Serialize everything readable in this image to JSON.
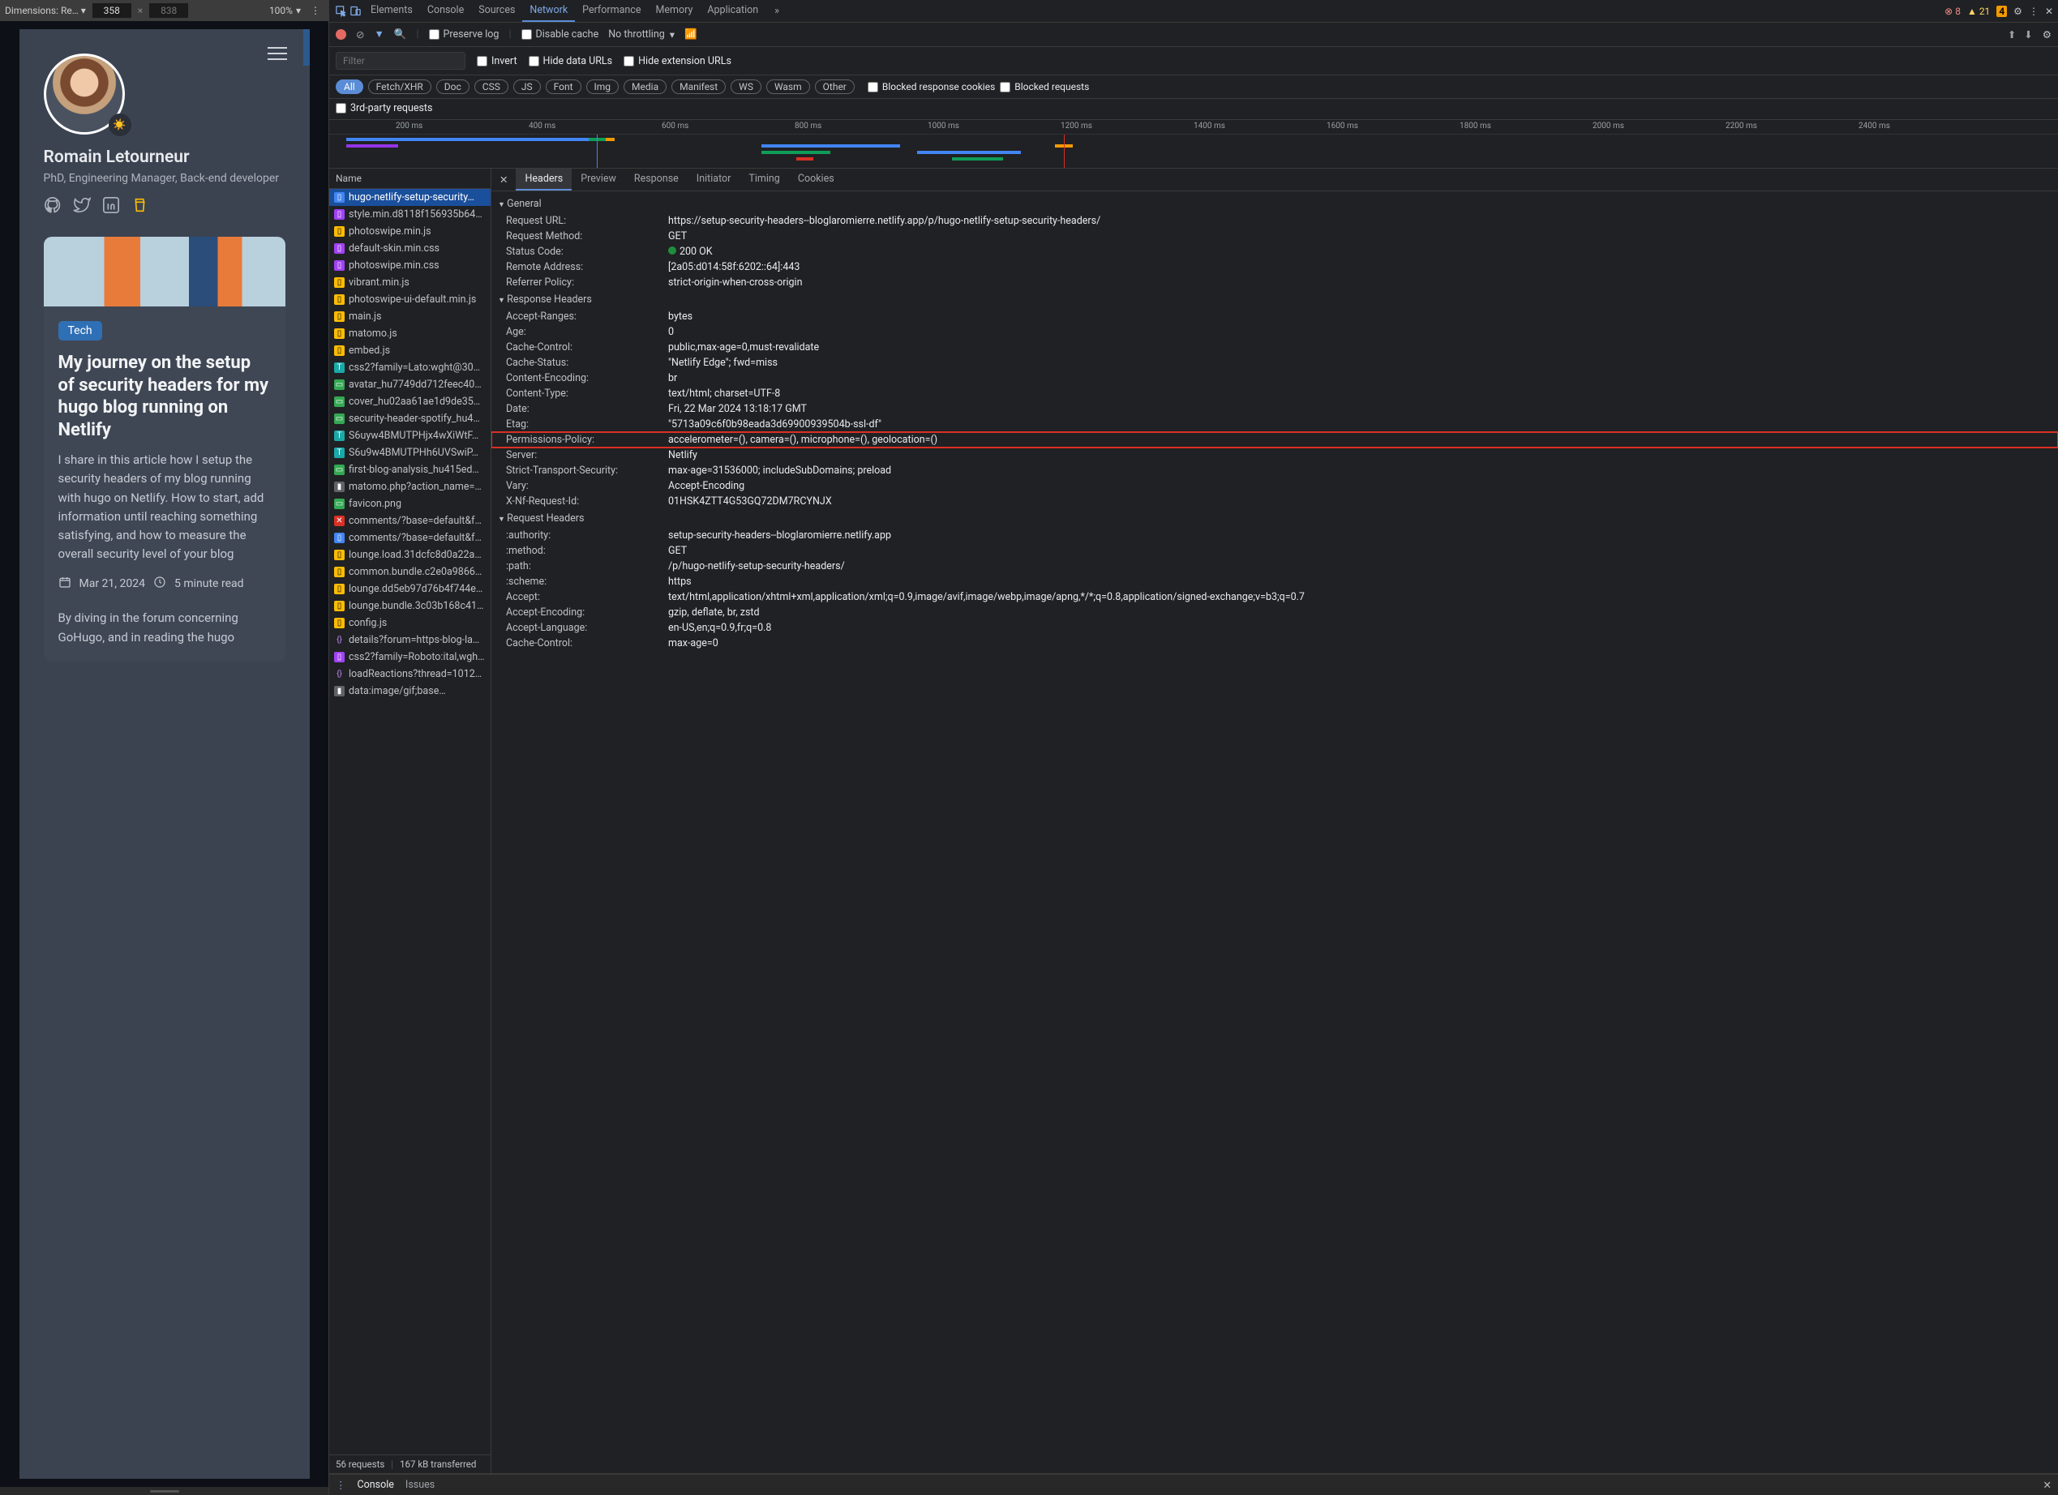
{
  "preview_toolbar": {
    "dimensions_label": "Dimensions: Re…",
    "width": "358",
    "height": "838",
    "zoom": "100%"
  },
  "site": {
    "name": "Romain Letourneur",
    "subtitle": "PhD, Engineering Manager, Back-end developer",
    "theme_icon": "☀️",
    "card": {
      "tag": "Tech",
      "title": "My journey on the setup of security headers for my hugo blog running on Netlify",
      "description": "I share in this article how I setup the security headers of my blog running with hugo on Netlify. How to start, add information until reaching something satisfying, and how to measure the overall security level of your blog",
      "date": "Mar 21, 2024",
      "read": "5 minute read",
      "excerpt": "By diving in the forum concerning GoHugo, and in reading the hugo"
    }
  },
  "devtools": {
    "tabs": [
      "Elements",
      "Console",
      "Sources",
      "Network",
      "Performance",
      "Memory",
      "Application"
    ],
    "active_tab": "Network",
    "badges": {
      "errors": "8",
      "warnings": "21",
      "info": "4"
    },
    "sub": {
      "preserve": "Preserve log",
      "disable_cache": "Disable cache",
      "throttle": "No throttling"
    },
    "filter": {
      "placeholder": "Filter",
      "invert": "Invert",
      "hide_data": "Hide data URLs",
      "hide_ext": "Hide extension URLs"
    },
    "types": [
      "All",
      "Fetch/XHR",
      "Doc",
      "CSS",
      "JS",
      "Font",
      "Img",
      "Media",
      "Manifest",
      "WS",
      "Wasm",
      "Other"
    ],
    "type_opts": {
      "blocked_cookies": "Blocked response cookies",
      "blocked_req": "Blocked requests"
    },
    "third_party": "3rd-party requests",
    "timeline_ticks": [
      "200 ms",
      "400 ms",
      "600 ms",
      "800 ms",
      "1000 ms",
      "1200 ms",
      "1400 ms",
      "1600 ms",
      "1800 ms",
      "2000 ms",
      "2200 ms",
      "2400 ms"
    ],
    "req_header": "Name",
    "requests": [
      {
        "icon": "doc",
        "name": "hugo-netlify-setup-security…",
        "sel": true
      },
      {
        "icon": "css",
        "name": "style.min.d8118f156935b64…"
      },
      {
        "icon": "js",
        "name": "photoswipe.min.js"
      },
      {
        "icon": "css",
        "name": "default-skin.min.css"
      },
      {
        "icon": "css",
        "name": "photoswipe.min.css"
      },
      {
        "icon": "js",
        "name": "vibrant.min.js"
      },
      {
        "icon": "js",
        "name": "photoswipe-ui-default.min.js"
      },
      {
        "icon": "js",
        "name": "main.js"
      },
      {
        "icon": "js",
        "name": "matomo.js"
      },
      {
        "icon": "js",
        "name": "embed.js"
      },
      {
        "icon": "font",
        "name": "css2?family=Lato:wght@30…"
      },
      {
        "icon": "img",
        "name": "avatar_hu7749dd712feec40…"
      },
      {
        "icon": "img",
        "name": "cover_hu02aa61ae1d9de35…"
      },
      {
        "icon": "img",
        "name": "security-header-spotify_hu4…"
      },
      {
        "icon": "font",
        "name": "S6uyw4BMUTPHjx4wXiWtF…"
      },
      {
        "icon": "font",
        "name": "S6u9w4BMUTPHh6UVSwiP…"
      },
      {
        "icon": "img",
        "name": "first-blog-analysis_hu415ed…"
      },
      {
        "icon": "other",
        "name": "matomo.php?action_name=…"
      },
      {
        "icon": "img",
        "name": "favicon.png"
      },
      {
        "icon": "err",
        "name": "comments/?base=default&f…"
      },
      {
        "icon": "doc",
        "name": "comments/?base=default&f…"
      },
      {
        "icon": "js",
        "name": "lounge.load.31dcfc8d0a22a…"
      },
      {
        "icon": "js",
        "name": "common.bundle.c2e0a9866…"
      },
      {
        "icon": "js",
        "name": "lounge.dd5eb97d76b4f744e…"
      },
      {
        "icon": "js",
        "name": "lounge.bundle.3c03b168c41…"
      },
      {
        "icon": "js",
        "name": "config.js"
      },
      {
        "icon": "fetch",
        "name": "details?forum=https-blog-la…"
      },
      {
        "icon": "css",
        "name": "css2?family=Roboto:ital,wgh…"
      },
      {
        "icon": "fetch",
        "name": "loadReactions?thread=1012…"
      },
      {
        "icon": "other",
        "name": "data:image/gif;base…"
      }
    ],
    "status_bar": {
      "count": "56 requests",
      "size": "167 kB transferred"
    },
    "detail_tabs": [
      "Headers",
      "Preview",
      "Response",
      "Initiator",
      "Timing",
      "Cookies"
    ],
    "detail_active": "Headers",
    "general_hdr": "General",
    "general": [
      {
        "k": "Request URL:",
        "v": "https://setup-security-headers--bloglaromierre.netlify.app/p/hugo-netlify-setup-security-headers/"
      },
      {
        "k": "Request Method:",
        "v": "GET"
      },
      {
        "k": "Status Code:",
        "v": "200 OK",
        "status": true
      },
      {
        "k": "Remote Address:",
        "v": "[2a05:d014:58f:6202::64]:443"
      },
      {
        "k": "Referrer Policy:",
        "v": "strict-origin-when-cross-origin"
      }
    ],
    "resp_hdr": "Response Headers",
    "response_headers": [
      {
        "k": "Accept-Ranges:",
        "v": "bytes"
      },
      {
        "k": "Age:",
        "v": "0"
      },
      {
        "k": "Cache-Control:",
        "v": "public,max-age=0,must-revalidate"
      },
      {
        "k": "Cache-Status:",
        "v": "\"Netlify Edge\"; fwd=miss"
      },
      {
        "k": "Content-Encoding:",
        "v": "br"
      },
      {
        "k": "Content-Type:",
        "v": "text/html; charset=UTF-8"
      },
      {
        "k": "Date:",
        "v": "Fri, 22 Mar 2024 13:18:17 GMT"
      },
      {
        "k": "Etag:",
        "v": "\"5713a09c6f0b98eada3d69900939504b-ssl-df\""
      },
      {
        "k": "Permissions-Policy:",
        "v": "accelerometer=(), camera=(), microphone=(), geolocation=()",
        "hl": true
      },
      {
        "k": "Server:",
        "v": "Netlify"
      },
      {
        "k": "Strict-Transport-Security:",
        "v": "max-age=31536000; includeSubDomains; preload"
      },
      {
        "k": "Vary:",
        "v": "Accept-Encoding"
      },
      {
        "k": "X-Nf-Request-Id:",
        "v": "01HSK4ZTT4G53GQ72DM7RCYNJX"
      }
    ],
    "req_hdr": "Request Headers",
    "request_headers": [
      {
        "k": ":authority:",
        "v": "setup-security-headers--bloglaromierre.netlify.app"
      },
      {
        "k": ":method:",
        "v": "GET"
      },
      {
        "k": ":path:",
        "v": "/p/hugo-netlify-setup-security-headers/"
      },
      {
        "k": ":scheme:",
        "v": "https"
      },
      {
        "k": "Accept:",
        "v": "text/html,application/xhtml+xml,application/xml;q=0.9,image/avif,image/webp,image/apng,*/*;q=0.8,application/signed-exchange;v=b3;q=0.7"
      },
      {
        "k": "Accept-Encoding:",
        "v": "gzip, deflate, br, zstd"
      },
      {
        "k": "Accept-Language:",
        "v": "en-US,en;q=0.9,fr;q=0.8"
      },
      {
        "k": "Cache-Control:",
        "v": "max-age=0"
      }
    ],
    "console": {
      "tab1": "Console",
      "tab2": "Issues"
    }
  }
}
